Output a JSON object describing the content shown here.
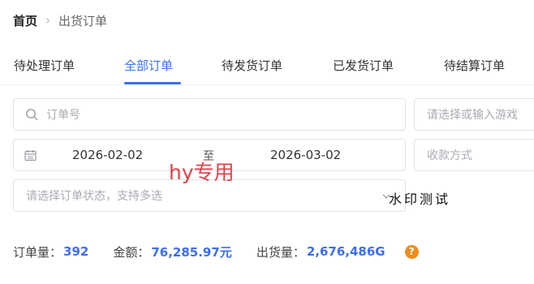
{
  "breadcrumb": {
    "home": "首页",
    "separator": "›",
    "current": "出货订单"
  },
  "tabs": [
    {
      "label": "待处理订单",
      "active": false
    },
    {
      "label": "全部订单",
      "active": true
    },
    {
      "label": "待发货订单",
      "active": false
    },
    {
      "label": "已发货订单",
      "active": false
    },
    {
      "label": "待结算订单",
      "active": false
    }
  ],
  "filters": {
    "order_number_placeholder": "订单号",
    "game_placeholder": "请选择或输入游戏",
    "date_start": "2026-02-02",
    "date_separator": "至",
    "date_end": "2026-03-02",
    "payment_placeholder": "收款方式",
    "status_placeholder": "请选择订单状态，支持多选"
  },
  "overlays": {
    "red_stamp": "hy专用",
    "watermark": "水印测试"
  },
  "summary": {
    "order_count_label": "订单量：",
    "order_count": "392",
    "amount_label": "金额：",
    "amount": "76,285.97元",
    "shipped_label": "出货量：",
    "shipped": "2,676,486G",
    "help_glyph": "?"
  },
  "colors": {
    "accent": "#3b6ef5",
    "stamp": "#e0414b",
    "help": "#f08c1b"
  },
  "icons": [
    "search-icon",
    "calendar-icon",
    "chevron-down-icon",
    "help-icon"
  ]
}
